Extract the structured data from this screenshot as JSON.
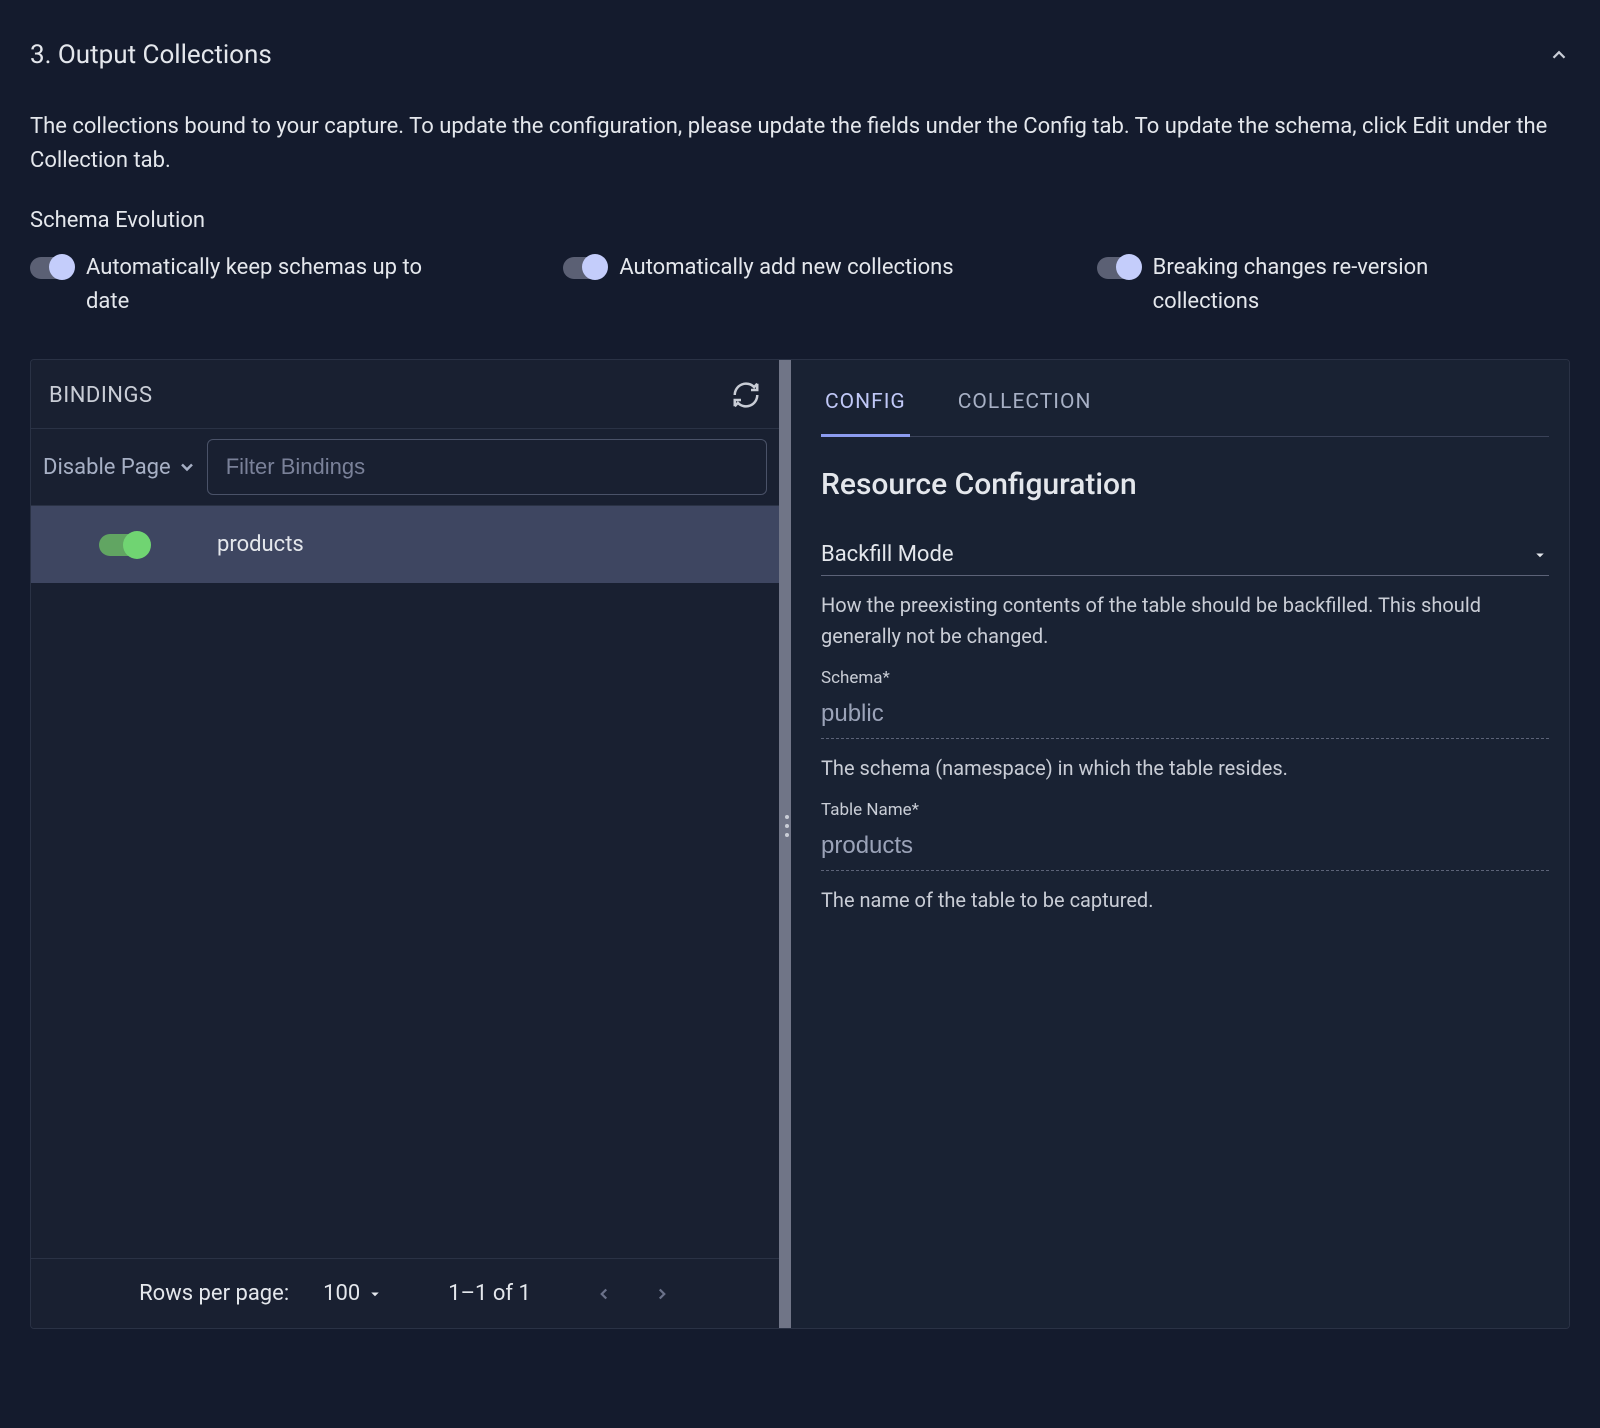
{
  "section": {
    "title": "3. Output Collections",
    "description": "The collections bound to your capture. To update the configuration, please update the fields under the Config tab. To update the schema, click Edit under the Collection tab."
  },
  "schemaEvolution": {
    "title": "Schema Evolution",
    "toggle1": "Automatically keep schemas up to date",
    "toggle2": "Automatically add new collections",
    "toggle3": "Breaking changes re-version collections"
  },
  "bindings": {
    "header": "BINDINGS",
    "disablePage": "Disable Page",
    "filterPlaceholder": "Filter Bindings",
    "item": "products"
  },
  "pagination": {
    "rowsLabel": "Rows per page:",
    "rowsValue": "100",
    "range": "1–1 of 1"
  },
  "tabs": {
    "config": "CONFIG",
    "collection": "COLLECTION"
  },
  "config": {
    "heading": "Resource Configuration",
    "backfillLabel": "Backfill Mode",
    "backfillHelp": "How the preexisting contents of the table should be backfilled. This should generally not be changed.",
    "schemaLabel": "Schema*",
    "schemaValue": "public",
    "schemaHelp": "The schema (namespace) in which the table resides.",
    "tableLabel": "Table Name*",
    "tableValue": "products",
    "tableHelp": "The name of the table to be captured."
  }
}
